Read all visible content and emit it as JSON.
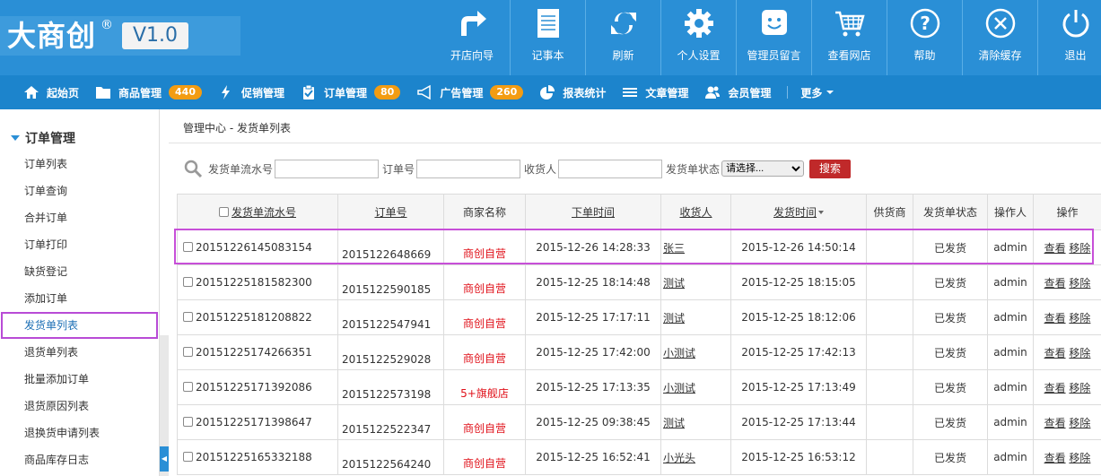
{
  "logo": {
    "name": "大商创",
    "reg": "®",
    "version": "V1.0"
  },
  "topnav": [
    {
      "label": "开店向导",
      "icon": "arrow-turn-icon"
    },
    {
      "label": "记事本",
      "icon": "notepad-icon"
    },
    {
      "label": "刷新",
      "icon": "refresh-icon"
    },
    {
      "label": "个人设置",
      "icon": "gear-icon"
    },
    {
      "label": "管理员留言",
      "icon": "smiley-message-icon"
    },
    {
      "label": "查看网店",
      "icon": "cart-icon"
    },
    {
      "label": "帮助",
      "icon": "help-icon"
    },
    {
      "label": "清除缓存",
      "icon": "clear-cache-icon"
    },
    {
      "label": "退出",
      "icon": "power-icon"
    }
  ],
  "mainnav": {
    "home": "起始页",
    "goods": "商品管理",
    "goods_badge": "440",
    "promo": "促销管理",
    "orders": "订单管理",
    "orders_badge": "80",
    "ads": "广告管理",
    "ads_badge": "260",
    "reports": "报表统计",
    "articles": "文章管理",
    "members": "会员管理",
    "more": "更多"
  },
  "sidebar": {
    "heading": "订单管理",
    "items": [
      "订单列表",
      "订单查询",
      "合并订单",
      "订单打印",
      "缺货登记",
      "添加订单",
      "发货单列表",
      "退货单列表",
      "批量添加订单",
      "退货原因列表",
      "退换货申请列表",
      "商品库存日志"
    ],
    "active_index": 6
  },
  "breadcrumb": {
    "root": "管理中心",
    "sep": " - ",
    "current": "发货单列表"
  },
  "search": {
    "label_delivery_sn": "发货单流水号",
    "label_order_sn": "订单号",
    "label_consignee": "收货人",
    "label_status": "发货单状态",
    "status_selected": "请选择...",
    "button": "搜索"
  },
  "table": {
    "headers": [
      "发货单流水号",
      "订单号",
      "商家名称",
      "下单时间",
      "收货人",
      "发货时间",
      "供货商",
      "发货单状态",
      "操作人",
      "操作"
    ],
    "rows": [
      {
        "sn": "20151226145083154",
        "order": "2015122648669",
        "shop": "商创自营",
        "order_time": "2015-12-26 14:28:33",
        "consignee": "张三",
        "ship_time": "2015-12-26 14:50:14",
        "supplier": "",
        "status": "已发货",
        "operator": "admin"
      },
      {
        "sn": "20151225181582300",
        "order": "2015122590185",
        "shop": "商创自营",
        "order_time": "2015-12-25 18:14:48",
        "consignee": "测试",
        "ship_time": "2015-12-25 18:15:05",
        "supplier": "",
        "status": "已发货",
        "operator": "admin"
      },
      {
        "sn": "20151225181208822",
        "order": "2015122547941",
        "shop": "商创自营",
        "order_time": "2015-12-25 17:17:11",
        "consignee": "测试",
        "ship_time": "2015-12-25 18:12:06",
        "supplier": "",
        "status": "已发货",
        "operator": "admin"
      },
      {
        "sn": "20151225174266351",
        "order": "2015122529028",
        "shop": "商创自营",
        "order_time": "2015-12-25 17:42:00",
        "consignee": "小测试",
        "ship_time": "2015-12-25 17:42:13",
        "supplier": "",
        "status": "已发货",
        "operator": "admin"
      },
      {
        "sn": "20151225171392086",
        "order": "2015122573198",
        "shop": "5+旗舰店",
        "order_time": "2015-12-25 17:13:35",
        "consignee": "小测试",
        "ship_time": "2015-12-25 17:13:49",
        "supplier": "",
        "status": "已发货",
        "operator": "admin"
      },
      {
        "sn": "20151225171398647",
        "order": "2015122522347",
        "shop": "商创自营",
        "order_time": "2015-12-25 09:38:45",
        "consignee": "测试",
        "ship_time": "2015-12-25 17:13:44",
        "supplier": "",
        "status": "已发货",
        "operator": "admin"
      },
      {
        "sn": "20151225165332188",
        "order": "2015122564240",
        "shop": "商创自营",
        "order_time": "2015-12-25 16:52:41",
        "consignee": "小光头",
        "ship_time": "2015-12-25 16:53:12",
        "supplier": "",
        "status": "已发货",
        "operator": "admin"
      }
    ],
    "op_view": "查看",
    "op_remove": "移除"
  }
}
